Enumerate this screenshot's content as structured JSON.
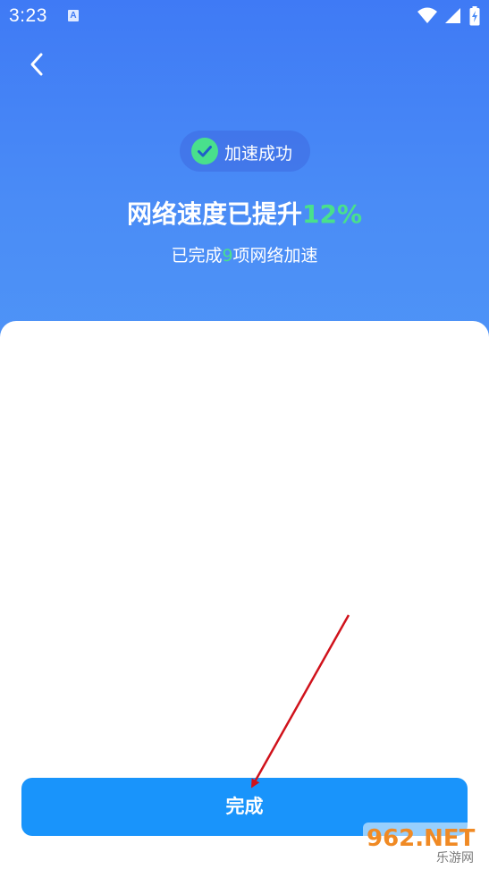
{
  "status_bar": {
    "time": "3:23",
    "notification_badge": "A",
    "icons": [
      "wifi-icon",
      "signal-icon",
      "battery-icon"
    ]
  },
  "nav": {
    "back_icon": "chevron-left-icon"
  },
  "result": {
    "badge_text": "加速成功",
    "headline_prefix": "网络速度已提升",
    "headline_value": "12%",
    "sub_prefix": "已完成",
    "sub_count": "9",
    "sub_suffix": "项网络加速"
  },
  "actions": {
    "done_label": "完成"
  },
  "watermark": {
    "text_top": "962.NET",
    "text_bottom": "乐游网"
  },
  "colors": {
    "header_blue": "#4a8cf6",
    "accent_green": "#49e08c",
    "button_blue": "#1994fb",
    "annotation_red": "#d0121b"
  }
}
